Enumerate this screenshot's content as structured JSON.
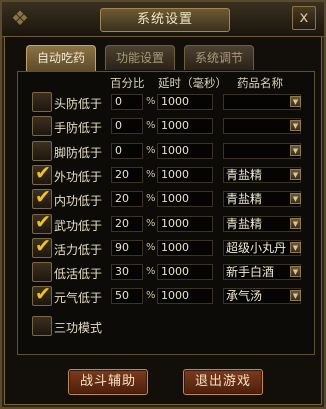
{
  "window": {
    "title": "系统设置",
    "close_glyph": "x"
  },
  "tabs": [
    {
      "label": "自动吃药",
      "active": true
    },
    {
      "label": "功能设置",
      "active": false
    },
    {
      "label": "系统调节",
      "active": false
    }
  ],
  "headers": {
    "percent": "百分比",
    "delay": "延时（毫秒）",
    "drug_name": "药品名称"
  },
  "rows": [
    {
      "label": "头防低于",
      "checked": false,
      "percent": "0",
      "delay": "1000",
      "drug": ""
    },
    {
      "label": "手防低于",
      "checked": false,
      "percent": "0",
      "delay": "1000",
      "drug": ""
    },
    {
      "label": "脚防低于",
      "checked": false,
      "percent": "0",
      "delay": "1000",
      "drug": ""
    },
    {
      "label": "外功低于",
      "checked": true,
      "percent": "20",
      "delay": "1000",
      "drug": "青盐精"
    },
    {
      "label": "内功低于",
      "checked": true,
      "percent": "20",
      "delay": "1000",
      "drug": "青盐精"
    },
    {
      "label": "武功低于",
      "checked": true,
      "percent": "20",
      "delay": "1000",
      "drug": "青盐精"
    },
    {
      "label": "活力低于",
      "checked": true,
      "percent": "90",
      "delay": "1000",
      "drug": "超级小丸丹"
    },
    {
      "label": "低活低于",
      "checked": false,
      "percent": "30",
      "delay": "1000",
      "drug": "新手白酒"
    },
    {
      "label": "元气低于",
      "checked": true,
      "percent": "50",
      "delay": "1000",
      "drug": "承气汤"
    }
  ],
  "percent_sign": "%",
  "sangong": {
    "label": "三功模式",
    "checked": false
  },
  "buttons": {
    "battle_assist": "战斗辅助",
    "exit_game": "退出游戏"
  },
  "colors": {
    "check_tick": "#f2c21c",
    "active_tab": "#8b7244",
    "button": "#7e3b1d"
  }
}
